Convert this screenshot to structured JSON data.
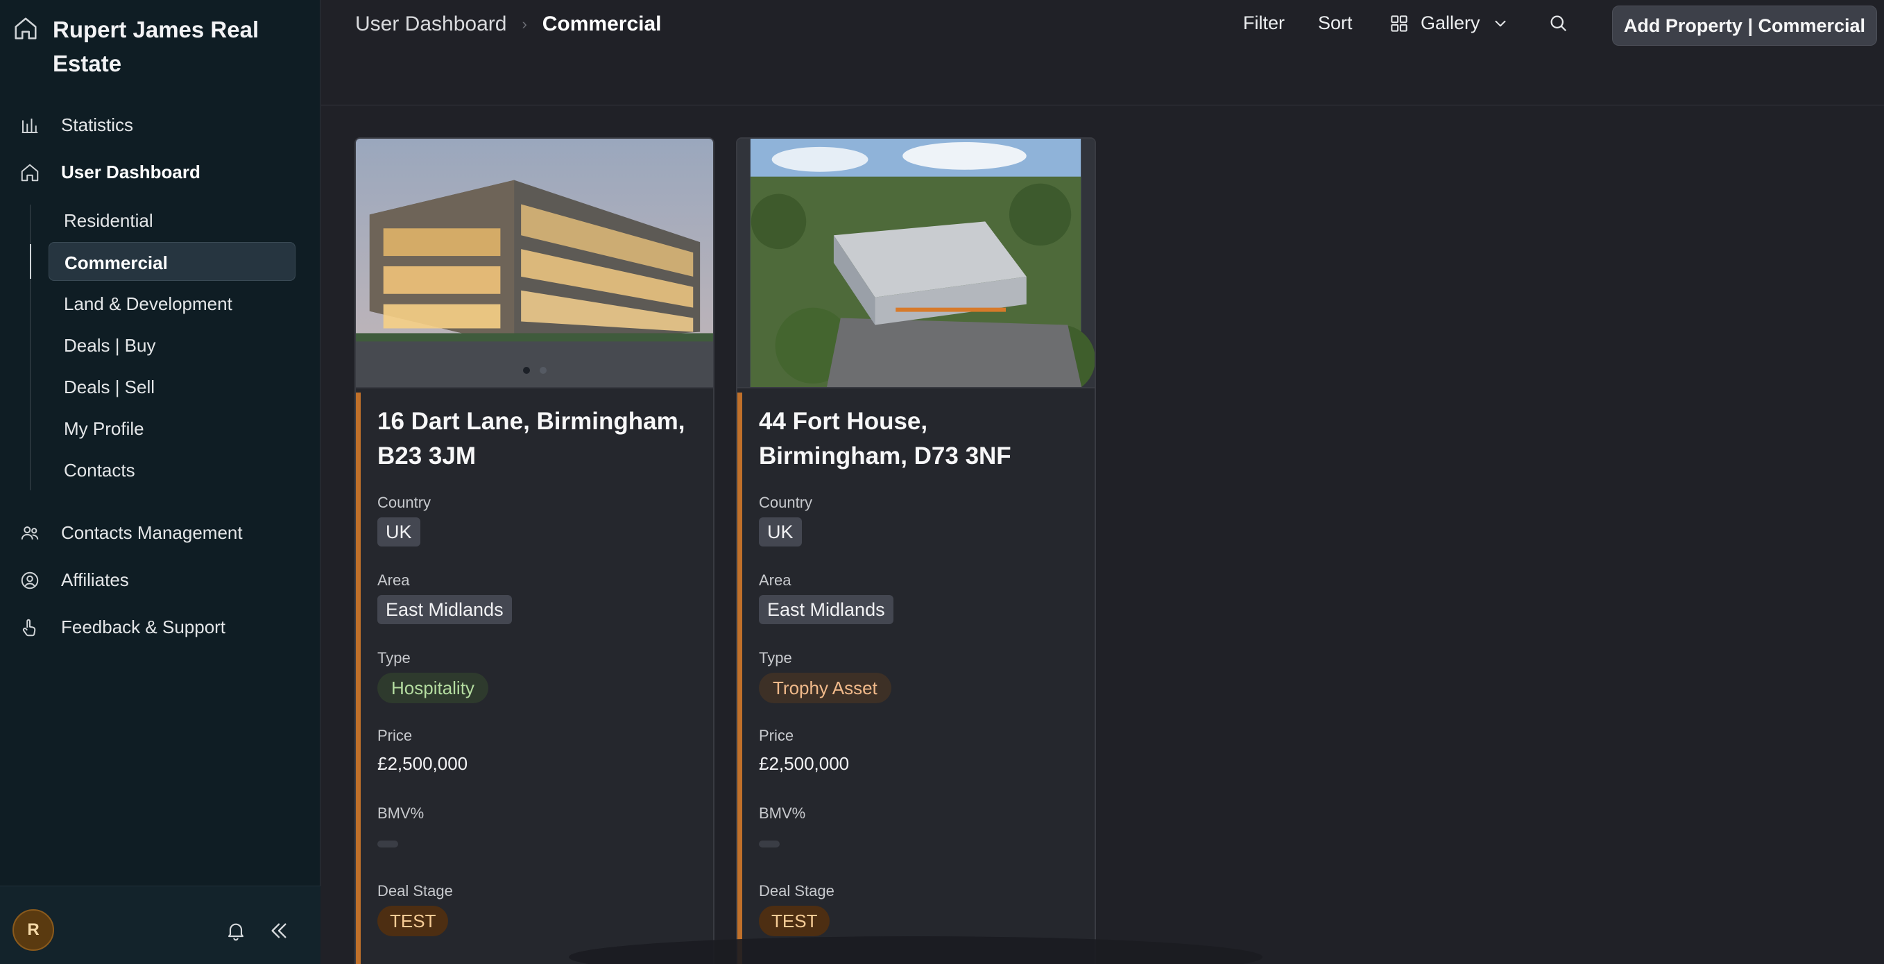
{
  "sidebar": {
    "brand": "Rupert James Real Estate",
    "nav": {
      "statistics": "Statistics",
      "user_dashboard": "User Dashboard",
      "contacts_management": "Contacts Management",
      "affiliates": "Affiliates",
      "feedback_support": "Feedback & Support"
    },
    "sub_items": [
      "Residential",
      "Commercial",
      "Land & Development",
      "Deals | Buy",
      "Deals | Sell",
      "My Profile",
      "Contacts"
    ],
    "active_sub_item": "Commercial",
    "avatar_initial": "R"
  },
  "header": {
    "breadcrumb_parent": "User Dashboard",
    "breadcrumb_current": "Commercial",
    "filter_label": "Filter",
    "sort_label": "Sort",
    "view_label": "Gallery",
    "add_button_label": "Add Property | Commercial"
  },
  "cards": [
    {
      "title": "16 Dart Lane, Birmingham, B23 3JM",
      "country_label": "Country",
      "country": "UK",
      "area_label": "Area",
      "area": "East Midlands",
      "type_label": "Type",
      "type": "Hospitality",
      "price_label": "Price",
      "price": "£2,500,000",
      "bmv_label": "BMV%",
      "stage_label": "Deal Stage",
      "stage": "TEST"
    },
    {
      "title": "44 Fort House, Birmingham, D73 3NF",
      "country_label": "Country",
      "country": "UK",
      "area_label": "Area",
      "area": "East Midlands",
      "type_label": "Type",
      "type": "Trophy Asset",
      "price_label": "Price",
      "price": "£2,500,000",
      "bmv_label": "BMV%",
      "stage_label": "Deal Stage",
      "stage": "TEST"
    }
  ],
  "colors": {
    "sidebar_bg": "#0f1d24",
    "main_bg": "#202127",
    "accent_bar": "#c0702a",
    "type_hospitality": "#b4dca0",
    "type_trophy": "#f0b98a",
    "stage_bg": "#4d2e12"
  },
  "icons": {
    "brand": "home-icon",
    "statistics": "bar-chart-icon",
    "user_dashboard": "home-icon",
    "contacts_management": "users-icon",
    "affiliates": "user-circle-icon",
    "feedback_support": "hand-pointer-icon",
    "view": "grid-icon",
    "search": "search-icon",
    "notifications": "bell-icon",
    "collapse": "double-chevron-left-icon"
  }
}
